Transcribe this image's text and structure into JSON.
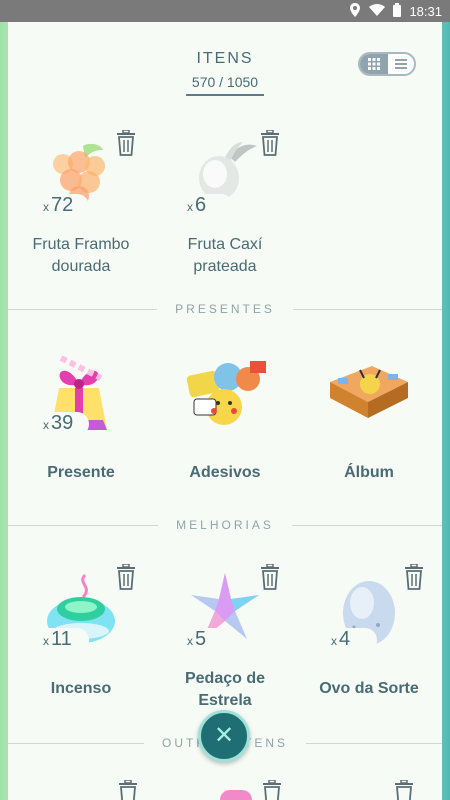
{
  "status_bar": {
    "time": "18:31",
    "icons": [
      "location-icon",
      "wifi-icon",
      "battery-icon"
    ]
  },
  "header": {
    "title": "ITENS",
    "count": "570 / 1050"
  },
  "view_toggle": {
    "options": [
      "grid-icon",
      "list-icon"
    ]
  },
  "sections": {
    "berries": {
      "items": [
        {
          "name": "Fruta Frambo dourada",
          "qty_prefix": "x",
          "qty": "72",
          "icon": "golden-razz-berry-icon"
        },
        {
          "name": "Fruta Caxí prateada",
          "qty_prefix": "x",
          "qty": "6",
          "icon": "silver-pinap-berry-icon"
        }
      ]
    },
    "presentes": {
      "label": "PRESENTES",
      "items": [
        {
          "name": "Presente",
          "qty_prefix": "x",
          "qty": "39",
          "icon": "gift-icon"
        },
        {
          "name": "Adesivos",
          "icon": "stickers-icon"
        },
        {
          "name": "Álbum",
          "icon": "album-icon"
        }
      ]
    },
    "melhorias": {
      "label": "MELHORIAS",
      "items": [
        {
          "name": "Incenso",
          "qty_prefix": "x",
          "qty": "11",
          "icon": "incense-icon"
        },
        {
          "name": "Pedaço de Estrela",
          "qty_prefix": "x",
          "qty": "5",
          "icon": "star-piece-icon"
        },
        {
          "name": "Ovo da Sorte",
          "qty_prefix": "x",
          "qty": "4",
          "icon": "lucky-egg-icon"
        }
      ]
    },
    "outros": {
      "label": "OUTROS ITENS"
    }
  },
  "fab": {
    "icon": "close-icon"
  }
}
